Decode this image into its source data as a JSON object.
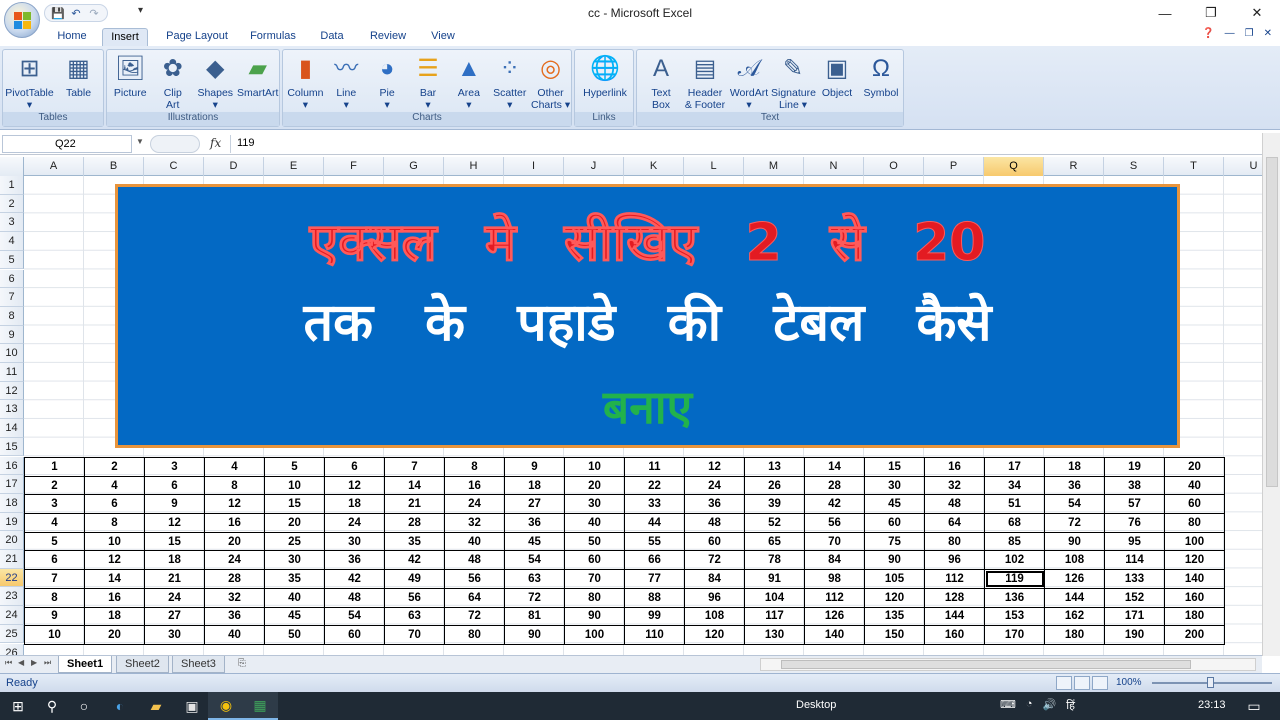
{
  "window": {
    "title": "cc - Microsoft Excel"
  },
  "ribbon": {
    "tabs": [
      {
        "label": "Home",
        "active": false
      },
      {
        "label": "Insert",
        "active": true
      },
      {
        "label": "Page Layout",
        "active": false
      },
      {
        "label": "Formulas",
        "active": false
      },
      {
        "label": "Data",
        "active": false
      },
      {
        "label": "Review",
        "active": false
      },
      {
        "label": "View",
        "active": false
      }
    ],
    "groups": [
      {
        "label": "Tables",
        "buttons": [
          {
            "line1": "PivotTable",
            "line2": "▾",
            "icon": "pivot-table-icon"
          },
          {
            "line1": "Table",
            "line2": "",
            "icon": "table-icon"
          }
        ]
      },
      {
        "label": "Illustrations",
        "buttons": [
          {
            "line1": "Picture",
            "line2": "",
            "icon": "picture-icon"
          },
          {
            "line1": "Clip",
            "line2": "Art",
            "icon": "clip-art-icon"
          },
          {
            "line1": "Shapes",
            "line2": "▾",
            "icon": "shapes-icon"
          },
          {
            "line1": "SmartArt",
            "line2": "",
            "icon": "smartart-icon"
          }
        ]
      },
      {
        "label": "Charts",
        "buttons": [
          {
            "line1": "Column",
            "line2": "▾",
            "icon": "column-chart-icon"
          },
          {
            "line1": "Line",
            "line2": "▾",
            "icon": "line-chart-icon"
          },
          {
            "line1": "Pie",
            "line2": "▾",
            "icon": "pie-chart-icon"
          },
          {
            "line1": "Bar",
            "line2": "▾",
            "icon": "bar-chart-icon"
          },
          {
            "line1": "Area",
            "line2": "▾",
            "icon": "area-chart-icon"
          },
          {
            "line1": "Scatter",
            "line2": "▾",
            "icon": "scatter-chart-icon"
          },
          {
            "line1": "Other",
            "line2": "Charts ▾",
            "icon": "other-charts-icon"
          }
        ]
      },
      {
        "label": "Links",
        "buttons": [
          {
            "line1": "Hyperlink",
            "line2": "",
            "icon": "hyperlink-icon"
          }
        ]
      },
      {
        "label": "Text",
        "buttons": [
          {
            "line1": "Text",
            "line2": "Box",
            "icon": "text-box-icon"
          },
          {
            "line1": "Header",
            "line2": "& Footer",
            "icon": "header-footer-icon"
          },
          {
            "line1": "WordArt",
            "line2": "▾",
            "icon": "wordart-icon"
          },
          {
            "line1": "Signature",
            "line2": "Line ▾",
            "icon": "signature-line-icon"
          },
          {
            "line1": "Object",
            "line2": "",
            "icon": "object-icon"
          },
          {
            "line1": "Symbol",
            "line2": "",
            "icon": "symbol-icon"
          }
        ]
      }
    ]
  },
  "formula_bar": {
    "name_box": "Q22",
    "fx": "fx",
    "value": "119"
  },
  "columns": [
    "A",
    "B",
    "C",
    "D",
    "E",
    "F",
    "G",
    "H",
    "I",
    "J",
    "K",
    "L",
    "M",
    "N",
    "O",
    "P",
    "Q",
    "R",
    "S",
    "T",
    "U"
  ],
  "selected_column": "Q",
  "rows": [
    "1",
    "2",
    "3",
    "4",
    "5",
    "6",
    "7",
    "8",
    "9",
    "10",
    "11",
    "12",
    "13",
    "14",
    "15",
    "16",
    "17",
    "18",
    "19",
    "20",
    "21",
    "22",
    "23",
    "24",
    "25",
    "26"
  ],
  "selected_row": "22",
  "banner": {
    "line1": "एक्सल मे सीखिए 2 से 20",
    "line2": "तक के पहाडे की टेबल कैसे",
    "line3": "बनाए",
    "colors": {
      "background": "#0369c4",
      "border": "#e8943c",
      "line1": "#e31b22",
      "line2": "#ffffff",
      "line3": "#22b24c"
    }
  },
  "table": [
    [
      "1",
      "2",
      "3",
      "4",
      "5",
      "6",
      "7",
      "8",
      "9",
      "10",
      "11",
      "12",
      "13",
      "14",
      "15",
      "16",
      "17",
      "18",
      "19",
      "20"
    ],
    [
      "2",
      "4",
      "6",
      "8",
      "10",
      "12",
      "14",
      "16",
      "18",
      "20",
      "22",
      "24",
      "26",
      "28",
      "30",
      "32",
      "34",
      "36",
      "38",
      "40"
    ],
    [
      "3",
      "6",
      "9",
      "12",
      "15",
      "18",
      "21",
      "24",
      "27",
      "30",
      "33",
      "36",
      "39",
      "42",
      "45",
      "48",
      "51",
      "54",
      "57",
      "60"
    ],
    [
      "4",
      "8",
      "12",
      "16",
      "20",
      "24",
      "28",
      "32",
      "36",
      "40",
      "44",
      "48",
      "52",
      "56",
      "60",
      "64",
      "68",
      "72",
      "76",
      "80"
    ],
    [
      "5",
      "10",
      "15",
      "20",
      "25",
      "30",
      "35",
      "40",
      "45",
      "50",
      "55",
      "60",
      "65",
      "70",
      "75",
      "80",
      "85",
      "90",
      "95",
      "100"
    ],
    [
      "6",
      "12",
      "18",
      "24",
      "30",
      "36",
      "42",
      "48",
      "54",
      "60",
      "66",
      "72",
      "78",
      "84",
      "90",
      "96",
      "102",
      "108",
      "114",
      "120"
    ],
    [
      "7",
      "14",
      "21",
      "28",
      "35",
      "42",
      "49",
      "56",
      "63",
      "70",
      "77",
      "84",
      "91",
      "98",
      "105",
      "112",
      "119",
      "126",
      "133",
      "140"
    ],
    [
      "8",
      "16",
      "24",
      "32",
      "40",
      "48",
      "56",
      "64",
      "72",
      "80",
      "88",
      "96",
      "104",
      "112",
      "120",
      "128",
      "136",
      "144",
      "152",
      "160"
    ],
    [
      "9",
      "18",
      "27",
      "36",
      "45",
      "54",
      "63",
      "72",
      "81",
      "90",
      "99",
      "108",
      "117",
      "126",
      "135",
      "144",
      "153",
      "162",
      "171",
      "180"
    ],
    [
      "10",
      "20",
      "30",
      "40",
      "50",
      "60",
      "70",
      "80",
      "90",
      "100",
      "110",
      "120",
      "130",
      "140",
      "150",
      "160",
      "170",
      "180",
      "190",
      "200"
    ]
  ],
  "sheet_tabs": [
    {
      "label": "Sheet1",
      "active": true
    },
    {
      "label": "Sheet2",
      "active": false
    },
    {
      "label": "Sheet3",
      "active": false
    }
  ],
  "status": {
    "text": "Ready",
    "zoom": "100%"
  },
  "taskbar": {
    "desktop_label": "Desktop",
    "time": "23:13",
    "lang": "हिं"
  }
}
